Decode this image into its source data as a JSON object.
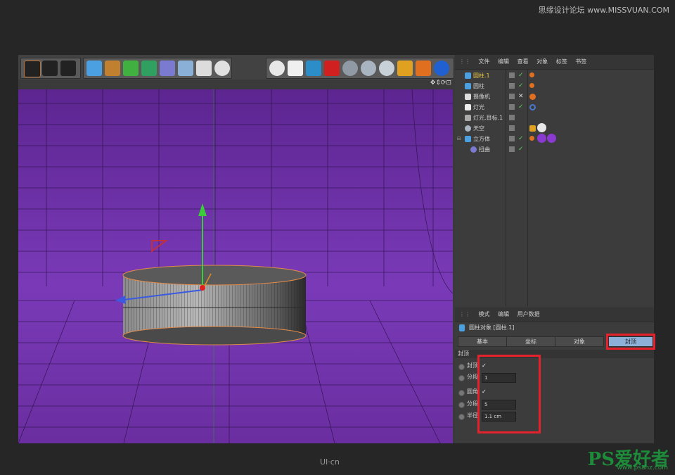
{
  "watermarks": {
    "top_right": "思缘设计论坛 www.MISSVUAN.COM",
    "bottom_center": "UI·cn",
    "ps_logo": "PS爱好者",
    "ps_url": "www.psahz.com"
  },
  "object_manager": {
    "menu": [
      "文件",
      "编辑",
      "查看",
      "对象",
      "标签",
      "书签"
    ],
    "objects": [
      {
        "name": "圆柱.1",
        "highlight": true
      },
      {
        "name": "圆柱",
        "highlight": false
      },
      {
        "name": "摄像机",
        "highlight": false
      },
      {
        "name": "灯光",
        "highlight": false
      },
      {
        "name": "灯光.目标.1",
        "highlight": false
      },
      {
        "name": "天空",
        "highlight": false
      },
      {
        "name": "立方体",
        "highlight": false
      },
      {
        "name": "扭曲",
        "highlight": false
      }
    ]
  },
  "attributes": {
    "menu": [
      "模式",
      "编辑",
      "用户数据"
    ],
    "object_title": "圆柱对象 [圆柱.1]",
    "tabs": [
      "基本",
      "坐标",
      "对象",
      "封顶"
    ],
    "active_tab": "封顶",
    "section": "封顶",
    "fields": [
      {
        "label": "封顶",
        "type": "check",
        "value": "✓"
      },
      {
        "label": "分段",
        "type": "number",
        "value": "1"
      },
      {
        "label": "圆角",
        "type": "check",
        "value": "✓"
      },
      {
        "label": "分段",
        "type": "number",
        "value": "5"
      },
      {
        "label": "半径",
        "type": "number",
        "value": "1.1 cm"
      }
    ]
  },
  "colors": {
    "highlight_text": "#e8c840",
    "active_tab": "#8db0d8",
    "annotation_red": "#e5212b",
    "viewport_purple": "#6a2ea0"
  }
}
